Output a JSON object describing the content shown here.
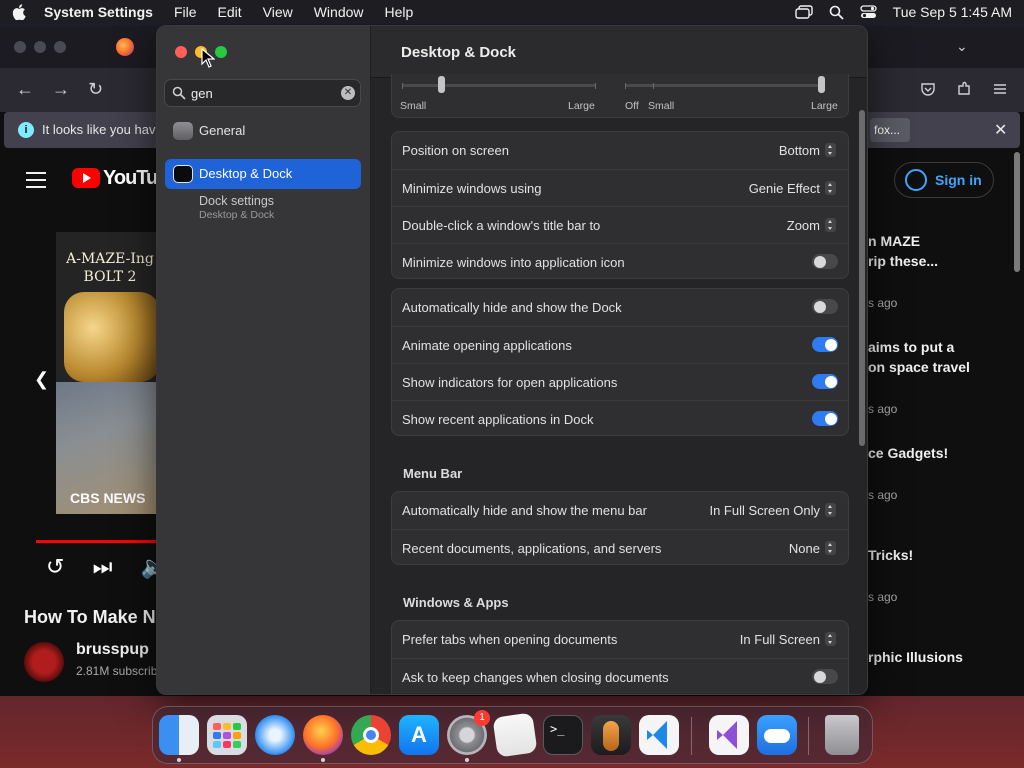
{
  "menubar": {
    "apple_icon": "apple-logo",
    "app_name": "System Settings",
    "menus": [
      "File",
      "Edit",
      "View",
      "Window",
      "Help"
    ],
    "status_icons": [
      "screen-mirroring-icon",
      "spotlight-search-icon",
      "control-center-icon"
    ],
    "clock": "Tue Sep 5  1:45 AM"
  },
  "browser": {
    "notice_text": "It looks like you haven't",
    "notice_button": "fox...",
    "youtube": {
      "wordmark": "YouTube",
      "video_title_art": "A-MAZE-Ing BOLT 2",
      "video_watermark": "CBS NEWS",
      "video_title": "How To Make Nut",
      "channel": "brusspup",
      "subscribers": "2.81M subscribers",
      "sign_in": "Sign in",
      "side_items": [
        {
          "title1": "n MAZE",
          "title2": "rip these...",
          "ago": "s ago"
        },
        {
          "title1": "aims to put a",
          "title2": "on space travel",
          "ago": "s ago"
        },
        {
          "title1": "ce Gadgets!",
          "title2": "",
          "ago": "s ago"
        },
        {
          "title1": "Tricks!",
          "title2": "",
          "ago": "s ago"
        },
        {
          "title1": "rphic Illusions",
          "title2": "",
          "ago": ""
        }
      ]
    }
  },
  "settings": {
    "search": {
      "value": "gen",
      "placeholder": "Search"
    },
    "sidebar_items": [
      {
        "label": "General",
        "icon": "gear-icon"
      },
      {
        "label": "Desktop & Dock",
        "icon": "desktop-dock-icon"
      }
    ],
    "search_result": {
      "title": "Dock settings",
      "path": "Desktop & Dock"
    },
    "title": "Desktop & Dock",
    "size_slider": {
      "min_label": "Small",
      "max_label": "Large",
      "value": 0.2
    },
    "magnification_slider": {
      "off_label": "Off",
      "min_label": "Small",
      "max_label": "Large",
      "value": 1.0
    },
    "dock_rows": [
      {
        "label": "Position on screen",
        "value": "Bottom"
      },
      {
        "label": "Minimize windows using",
        "value": "Genie Effect"
      },
      {
        "label": "Double-click a window's title bar to",
        "value": "Zoom"
      },
      {
        "label": "Minimize windows into application icon",
        "toggle": false
      }
    ],
    "dock_toggles": [
      {
        "label": "Automatically hide and show the Dock",
        "toggle": false
      },
      {
        "label": "Animate opening applications",
        "toggle": true
      },
      {
        "label": "Show indicators for open applications",
        "toggle": true
      },
      {
        "label": "Show recent applications in Dock",
        "toggle": true
      }
    ],
    "menu_bar_title": "Menu Bar",
    "menu_bar_rows": [
      {
        "label": "Automatically hide and show the menu bar",
        "value": "In Full Screen Only"
      },
      {
        "label": "Recent documents, applications, and servers",
        "value": "None"
      }
    ],
    "windows_apps_title": "Windows & Apps",
    "windows_apps_rows": [
      {
        "label": "Prefer tabs when opening documents",
        "value": "In Full Screen"
      },
      {
        "label": "Ask to keep changes when closing documents",
        "toggle": false
      }
    ]
  },
  "dock": {
    "apps": [
      "Finder",
      "Launchpad",
      "Safari",
      "Firefox",
      "Google Chrome",
      "App Store",
      "System Settings",
      "TextEdit",
      "Terminal",
      "GarageBand",
      "Visual Studio Code",
      "Visual Studio",
      "iCloud",
      "Trash"
    ],
    "settings_badge": "1",
    "colors": {
      "accent": "#2f7bf1",
      "selection": "#1f63d8"
    }
  }
}
